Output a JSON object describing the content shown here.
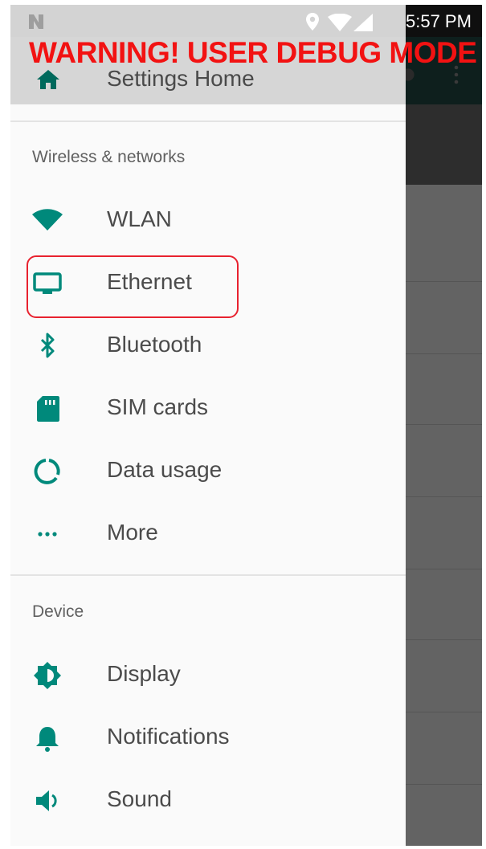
{
  "status_bar": {
    "time": "5:57 PM",
    "icons": [
      "n-icon",
      "location-icon",
      "wifi-icon",
      "signal-icon"
    ]
  },
  "warning_banner": "WARNING! USER DEBUG MODE",
  "drawer": {
    "header_label": "Settings Home",
    "sections": [
      {
        "title": "Wireless & networks",
        "items": [
          {
            "label": "WLAN",
            "icon": "wifi-icon"
          },
          {
            "label": "Ethernet",
            "icon": "monitor-icon",
            "highlighted": true
          },
          {
            "label": "Bluetooth",
            "icon": "bluetooth-icon"
          },
          {
            "label": "SIM cards",
            "icon": "sim-card-icon"
          },
          {
            "label": "Data usage",
            "icon": "data-usage-icon"
          },
          {
            "label": "More",
            "icon": "more-horiz-icon"
          }
        ]
      },
      {
        "title": "Device",
        "items": [
          {
            "label": "Display",
            "icon": "brightness-icon"
          },
          {
            "label": "Notifications",
            "icon": "bell-icon"
          },
          {
            "label": "Sound",
            "icon": "speaker-icon"
          }
        ]
      }
    ]
  },
  "colors": {
    "accent": "#008577",
    "warning": "#f21212",
    "highlight_border": "#e8222f",
    "drawer_header": "#d6d6d6",
    "drawer_bg": "#fafafa"
  }
}
